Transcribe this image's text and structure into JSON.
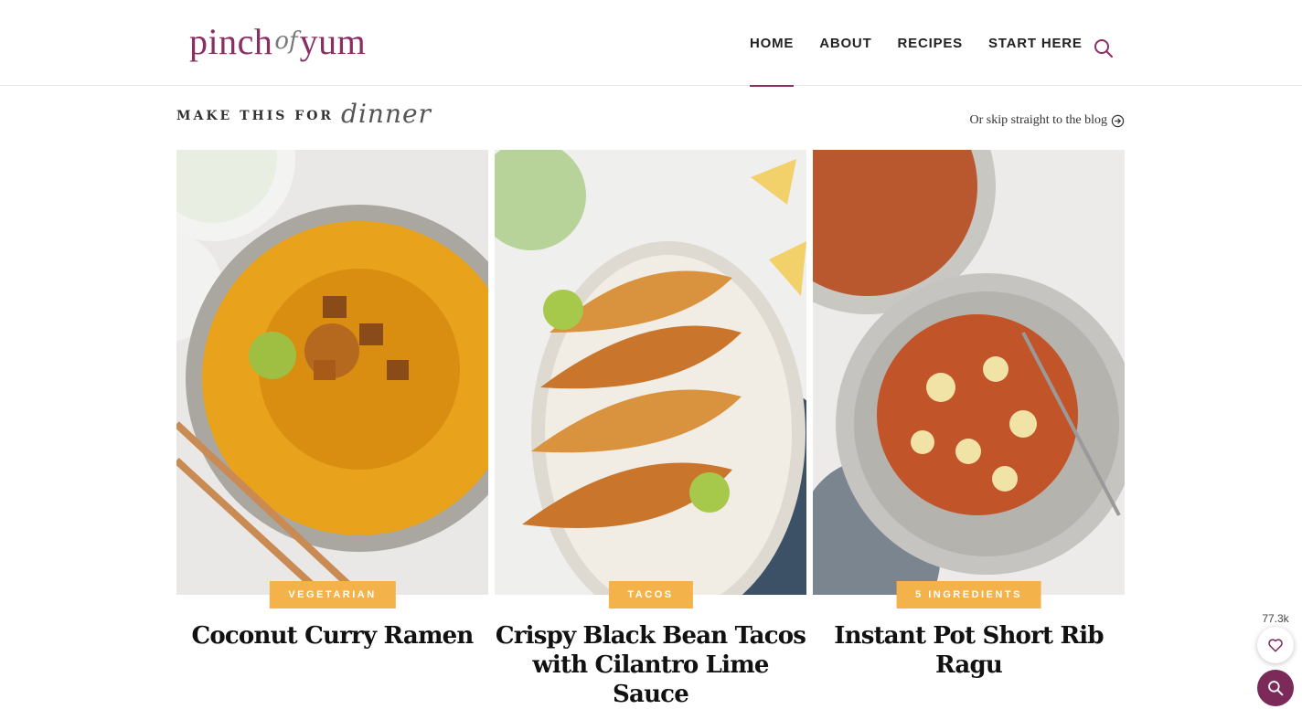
{
  "brand": {
    "logo_word1": "pinch",
    "logo_of": "of",
    "logo_word2": "yum"
  },
  "nav": {
    "items": [
      {
        "label": "HOME",
        "active": true
      },
      {
        "label": "ABOUT",
        "active": false
      },
      {
        "label": "RECIPES",
        "active": false
      },
      {
        "label": "START HERE",
        "active": false
      }
    ]
  },
  "section": {
    "heading": "MAKE THIS FOR",
    "heading_script": "dinner",
    "skip_link": "Or skip straight to the blog"
  },
  "cards": [
    {
      "category": "VEGETARIAN",
      "title": "Coconut Curry Ramen"
    },
    {
      "category": "TACOS",
      "title": "Crispy Black Bean Tacos with Cilantro Lime Sauce"
    },
    {
      "category": "5 INGREDIENTS",
      "title": "Instant Pot Short Rib Ragu"
    }
  ],
  "favorites": {
    "count": "77.3k"
  },
  "colors": {
    "brand": "#8a2f63",
    "badge": "#f3b34a",
    "floating_search": "#7b2a59"
  }
}
